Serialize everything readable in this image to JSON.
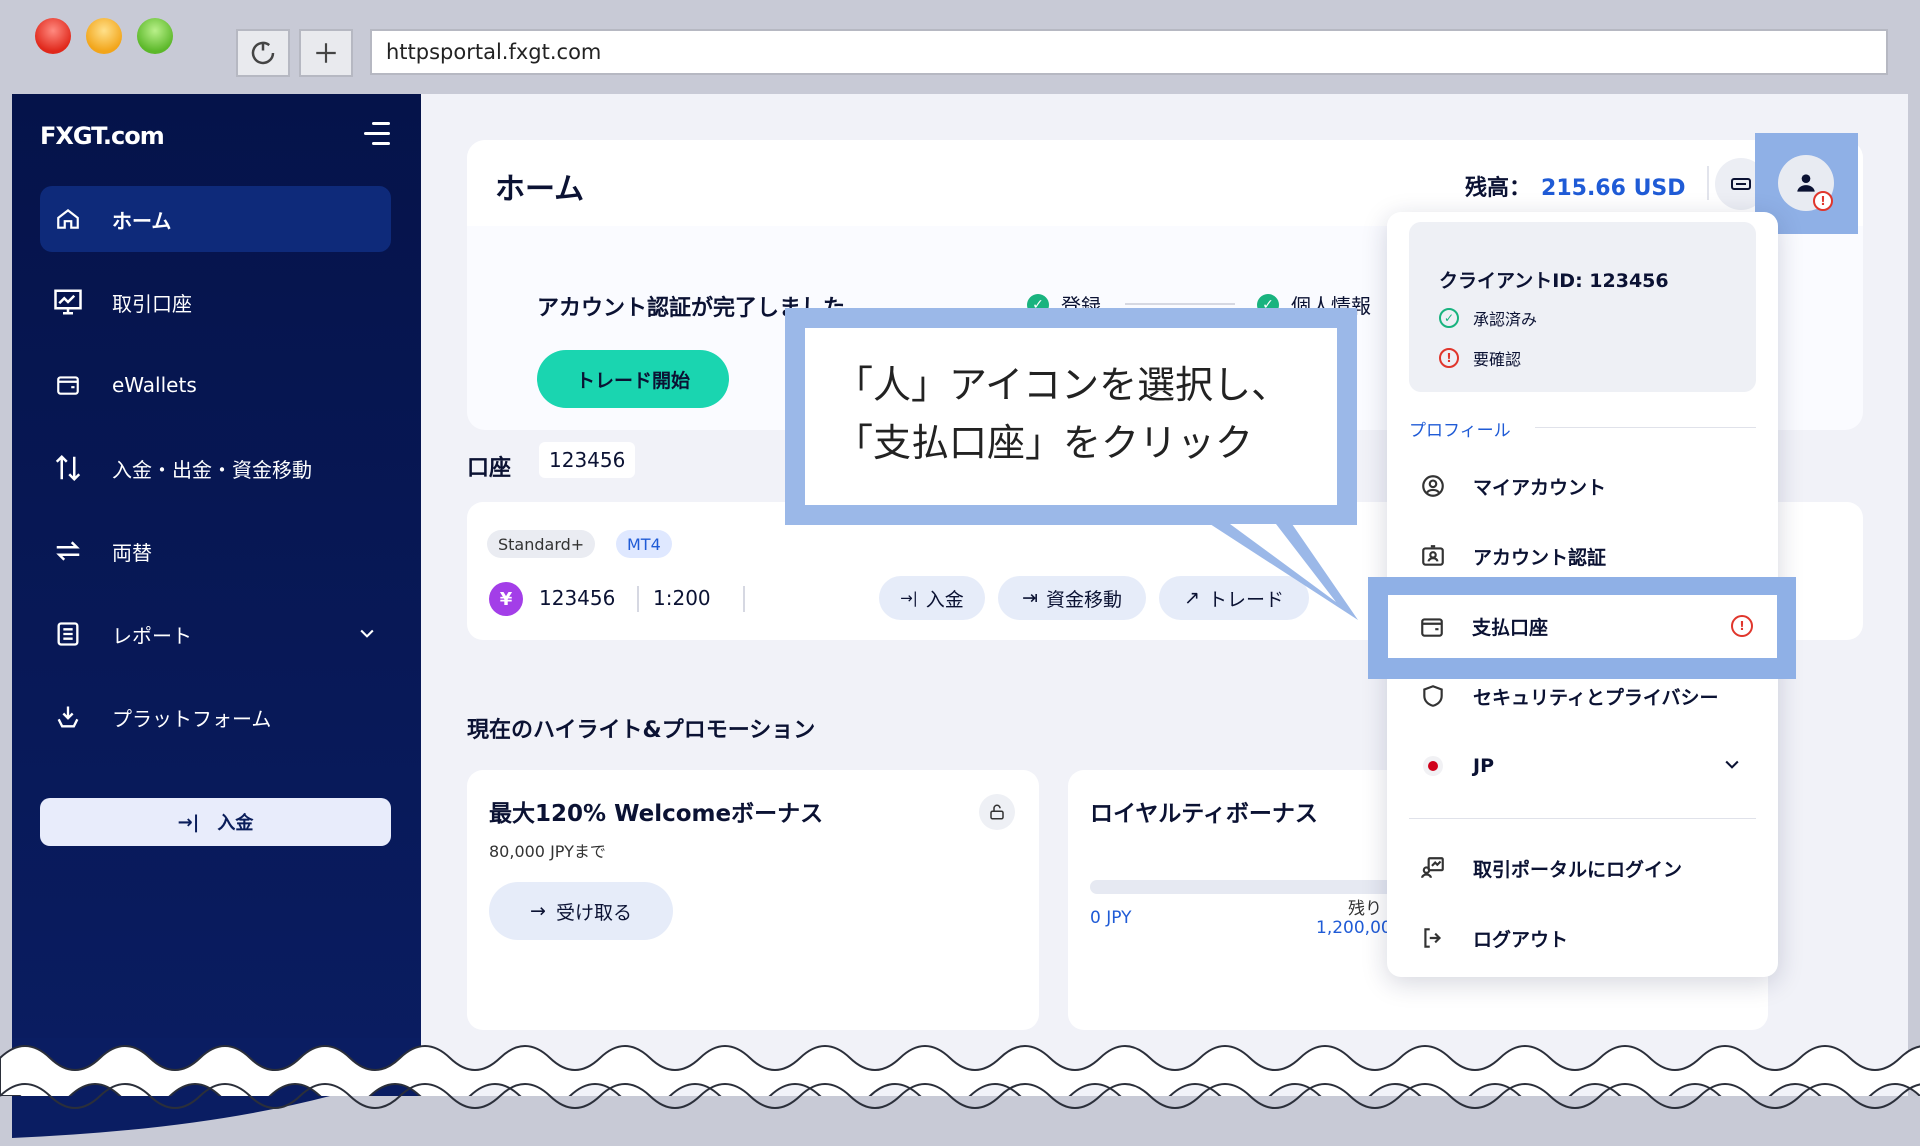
{
  "browser": {
    "url": "httpsportal.fxgt.com",
    "reload_icon": "reload-icon",
    "new_tab_icon": "plus-icon"
  },
  "sidebar": {
    "logo": "FXGT.com",
    "items": [
      {
        "label": "ホーム",
        "icon": "home-icon",
        "active": true
      },
      {
        "label": "取引口座",
        "icon": "chart-monitor-icon"
      },
      {
        "label": "eWallets",
        "icon": "wallet-icon"
      },
      {
        "label": "入金・出金・資金移動",
        "icon": "transfer-arrows-icon"
      },
      {
        "label": "両替",
        "icon": "exchange-icon"
      },
      {
        "label": "レポート",
        "icon": "report-icon"
      },
      {
        "label": "プラットフォーム",
        "icon": "platform-icon"
      }
    ],
    "deposit_button": "入金"
  },
  "header": {
    "title": "ホーム",
    "balance_label": "残高：",
    "balance_value": "215.66 USD"
  },
  "verification": {
    "title": "アカウント認証が完了しました",
    "steps": [
      "登録",
      "個人情報"
    ],
    "cta": "トレード開始"
  },
  "accounts": {
    "label": "口座",
    "selected": "123456",
    "card": {
      "type_tag": "Standard+",
      "platform_tag": "MT4",
      "currency_symbol": "¥",
      "number": "123456",
      "leverage": "1:200",
      "actions": [
        "入金",
        "資金移動",
        "トレード"
      ]
    }
  },
  "promotions": {
    "title": "現在のハイライト&プロモーション",
    "cards": [
      {
        "title": "最大120% Welcomeボーナス",
        "subtitle": "80,000 JPYまで",
        "button": "受け取る"
      },
      {
        "title": "ロイヤルティボーナス",
        "current": "0 JPY",
        "remaining_label": "残り",
        "remaining_value": "1,200,00"
      }
    ]
  },
  "dropdown": {
    "client_id": "クライアントID: 123456",
    "status_ok": "承認済み",
    "status_warn": "要確認",
    "section_label": "プロフィール",
    "items": [
      {
        "label": "マイアカウント",
        "icon": "user-circle-icon"
      },
      {
        "label": "アカウント認証",
        "icon": "id-card-icon"
      },
      {
        "label": "支払口座",
        "icon": "wallet-icon"
      },
      {
        "label": "セキュリティとプライバシー",
        "icon": "shield-icon"
      },
      {
        "label": "JP",
        "icon": "japan-flag-icon"
      },
      {
        "label": "取引ポータルにログイン",
        "icon": "portal-login-icon"
      },
      {
        "label": "ログアウト",
        "icon": "logout-icon"
      }
    ]
  },
  "callout": {
    "line1": "「人」アイコンを選択し、",
    "line2": "「支払口座」をクリック"
  },
  "colors": {
    "sidebar_bg": "#05134a",
    "accent_blue": "#1f5bd6",
    "teal_cta": "#1ad5b0",
    "highlight": "#8fb0e6",
    "warn_red": "#e0362c",
    "ok_green": "#19b37f"
  }
}
